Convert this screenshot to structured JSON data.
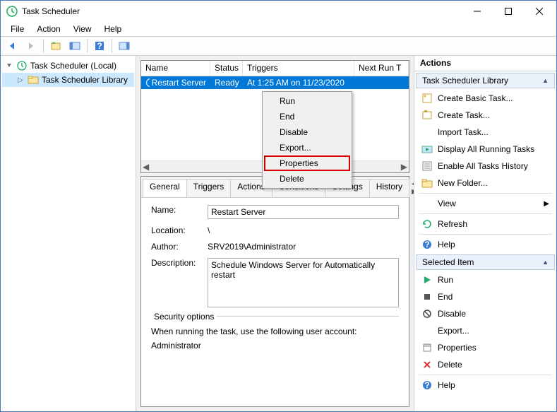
{
  "window": {
    "title": "Task Scheduler"
  },
  "menubar": [
    "File",
    "Action",
    "View",
    "Help"
  ],
  "tree": {
    "root": "Task Scheduler (Local)",
    "child": "Task Scheduler Library"
  },
  "list": {
    "columns": {
      "name": "Name",
      "status": "Status",
      "triggers": "Triggers",
      "next": "Next Run T"
    },
    "row": {
      "name": "Restart Server",
      "status": "Ready",
      "triggers": "At 1:25 AM on 11/23/2020"
    }
  },
  "context_menu": {
    "run": "Run",
    "end": "End",
    "disable": "Disable",
    "export": "Export...",
    "properties": "Properties",
    "delete": "Delete"
  },
  "detail": {
    "tabs": {
      "general": "General",
      "triggers": "Triggers",
      "actions": "Actions",
      "conditions": "Conditions",
      "settings": "Settings",
      "history": "History"
    },
    "labels": {
      "name": "Name:",
      "location": "Location:",
      "author": "Author:",
      "description": "Description:"
    },
    "name": "Restart Server",
    "location": "\\",
    "author": "SRV2019\\Administrator",
    "description": "Schedule Windows Server for Automatically restart",
    "security_legend": "Security options",
    "security_line": "When running the task, use the following user account:",
    "security_account": "Administrator"
  },
  "actions": {
    "header": "Actions",
    "group1": "Task Scheduler Library",
    "items1": {
      "create_basic": "Create Basic Task...",
      "create": "Create Task...",
      "import": "Import Task...",
      "display": "Display All Running Tasks",
      "enable_history": "Enable All Tasks History",
      "new_folder": "New Folder...",
      "view": "View",
      "refresh": "Refresh",
      "help": "Help"
    },
    "group2": "Selected Item",
    "items2": {
      "run": "Run",
      "end": "End",
      "disable": "Disable",
      "export": "Export...",
      "properties": "Properties",
      "delete": "Delete",
      "help": "Help"
    }
  }
}
